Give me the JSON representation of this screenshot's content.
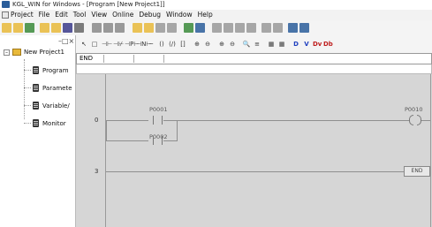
{
  "window": {
    "title": "KGL_WIN for Windows - [Program [New Project1]]"
  },
  "menubar": {
    "items": [
      "Project",
      "File",
      "Edit",
      "Tool",
      "View",
      "Online",
      "Debug",
      "Window",
      "Help"
    ]
  },
  "toolbar1": {
    "buttons": [
      {
        "name": "new-project-icon",
        "color": "#e8b93a"
      },
      {
        "name": "open-project-icon",
        "color": "#e8b93a"
      },
      {
        "name": "save-project-icon",
        "color": "#3a8a3a"
      },
      {
        "name": "new-file-icon",
        "color": "#e8b93a"
      },
      {
        "name": "open-file-icon",
        "color": "#e8b93a"
      },
      {
        "name": "save-file-icon",
        "color": "#3a3a8a"
      },
      {
        "name": "print-icon",
        "color": "#666666"
      },
      {
        "name": "cut-icon",
        "color": "#888888"
      },
      {
        "name": "copy-icon",
        "color": "#888888"
      },
      {
        "name": "paste-icon",
        "color": "#888888"
      },
      {
        "name": "ladder-view-1-icon",
        "color": "#e8b93a"
      },
      {
        "name": "ladder-view-2-icon",
        "color": "#e8b93a"
      },
      {
        "name": "ladder-view-3-icon",
        "color": "#999999"
      },
      {
        "name": "ladder-view-4-icon",
        "color": "#999999"
      },
      {
        "name": "monitor-icon",
        "color": "#3a8a3a"
      },
      {
        "name": "plc-io-icon",
        "color": "#2a5d9a"
      },
      {
        "name": "online-icon",
        "color": "#999999"
      },
      {
        "name": "connect-icon",
        "color": "#999999"
      },
      {
        "name": "run-icon",
        "color": "#999999"
      },
      {
        "name": "stop-icon",
        "color": "#999999"
      },
      {
        "name": "write-icon",
        "color": "#999999"
      },
      {
        "name": "read-icon",
        "color": "#999999"
      },
      {
        "name": "help-icon",
        "color": "#2a5d9a"
      },
      {
        "name": "context-help-icon",
        "color": "#2a5d9a"
      }
    ]
  },
  "toolbar2": {
    "buttons": [
      {
        "name": "select-icon",
        "glyph": "↖"
      },
      {
        "name": "rect-icon",
        "glyph": "□"
      },
      {
        "name": "contact-no-icon",
        "glyph": "⊣⊢"
      },
      {
        "name": "contact-nc-icon",
        "glyph": "⊣⊬"
      },
      {
        "name": "contact-p-icon",
        "glyph": "⊣P⊢"
      },
      {
        "name": "contact-n-icon",
        "glyph": "⊣N⊢"
      },
      {
        "name": "hline-icon",
        "glyph": "─"
      },
      {
        "name": "coil-icon",
        "glyph": "()"
      },
      {
        "name": "coil-nc-icon",
        "glyph": "(/)"
      },
      {
        "name": "func-icon",
        "glyph": "[]"
      },
      {
        "name": "zoom-in-icon",
        "glyph": "⊕"
      },
      {
        "name": "zoom-out-icon",
        "glyph": "⊖"
      },
      {
        "name": "zoom-fit-icon",
        "glyph": "⊕"
      },
      {
        "name": "zoom-100-icon",
        "glyph": "⊖"
      },
      {
        "name": "find-icon",
        "glyph": "🔍"
      },
      {
        "name": "list-icon",
        "glyph": "≡"
      },
      {
        "name": "var-icon",
        "glyph": "▦"
      },
      {
        "name": "comment-icon",
        "glyph": "▦"
      },
      {
        "name": "d-icon",
        "glyph": "D"
      },
      {
        "name": "v-icon",
        "glyph": "V"
      },
      {
        "name": "dv-icon",
        "glyph": "Dv"
      },
      {
        "name": "db-icon",
        "glyph": "Db"
      }
    ],
    "accent_blue": "#1f3fbf",
    "accent_red": "#bf1f1f"
  },
  "project_tree": {
    "root": "New Project1",
    "items": [
      "Program",
      "Paramete",
      "Variable/",
      "Monitor"
    ]
  },
  "edit_bar": {
    "cell1": "END",
    "cell2": "",
    "cell3": ""
  },
  "ladder": {
    "rungs": [
      {
        "step": "0"
      },
      {
        "step": "3"
      }
    ],
    "contacts": [
      {
        "label": "P0001"
      },
      {
        "label": "P0002"
      }
    ],
    "coil": {
      "label": "P0010"
    },
    "end_label": "END"
  }
}
